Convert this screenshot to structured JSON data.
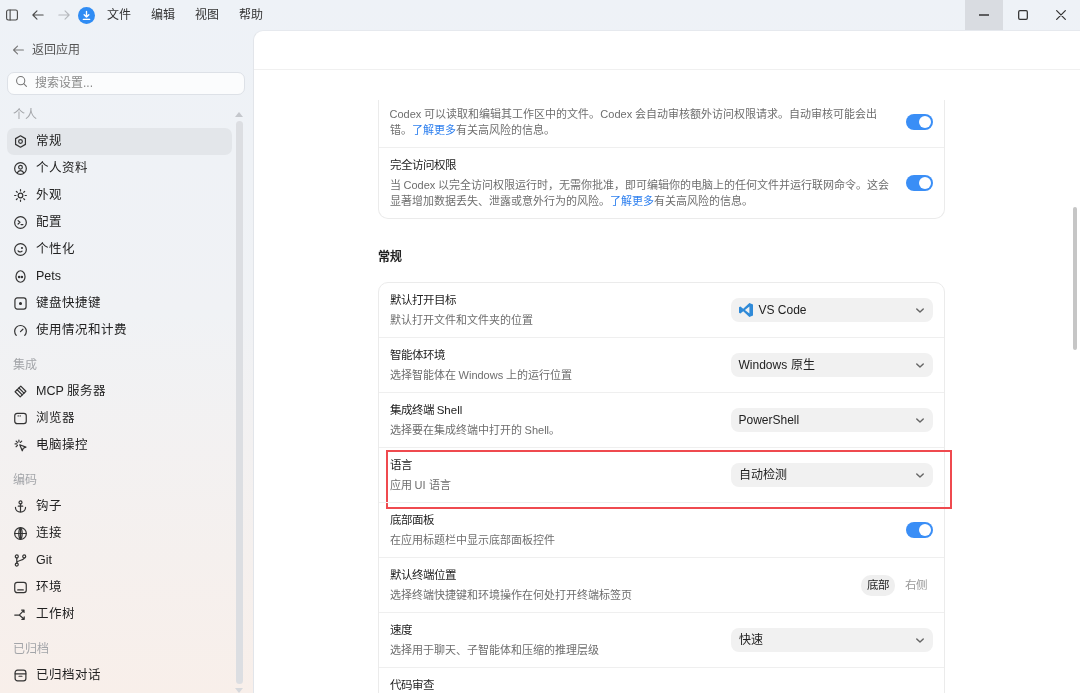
{
  "titlebar": {
    "nav_buttons": [
      {
        "kind": "sidebar",
        "disabled": false
      },
      {
        "kind": "back",
        "disabled": false
      },
      {
        "kind": "forward",
        "disabled": true
      }
    ],
    "menu": [
      "文件",
      "编辑",
      "视图",
      "帮助"
    ],
    "window_controls": [
      {
        "kind": "minimize",
        "hovered": true
      },
      {
        "kind": "maximize",
        "hovered": false
      },
      {
        "kind": "close",
        "hovered": false
      }
    ]
  },
  "sidebar": {
    "back_link": "返回应用",
    "search": {
      "placeholder": "搜索设置..."
    },
    "sections": [
      {
        "title": "个人",
        "items": [
          {
            "label": "常规",
            "selected": true
          },
          {
            "label": "个人资料",
            "selected": false
          },
          {
            "label": "外观",
            "selected": false
          },
          {
            "label": "配置",
            "selected": false
          },
          {
            "label": "个性化",
            "selected": false
          },
          {
            "label": "Pets",
            "selected": false
          },
          {
            "label": "键盘快捷键",
            "selected": false
          },
          {
            "label": "使用情况和计费",
            "selected": false
          }
        ]
      },
      {
        "title": "集成",
        "items": [
          {
            "label": "MCP 服务器",
            "selected": false
          },
          {
            "label": "浏览器",
            "selected": false
          },
          {
            "label": "电脑操控",
            "selected": false
          }
        ]
      },
      {
        "title": "编码",
        "items": [
          {
            "label": "钩子",
            "selected": false
          },
          {
            "label": "连接",
            "selected": false
          },
          {
            "label": "Git",
            "selected": false
          },
          {
            "label": "环境",
            "selected": false
          },
          {
            "label": "工作树",
            "selected": false
          }
        ]
      },
      {
        "title": "已归档",
        "items": [
          {
            "label": "已归档对话",
            "selected": false
          }
        ]
      }
    ]
  },
  "content": {
    "permissions": {
      "rows": [
        {
          "kind": "toggle",
          "on": true,
          "description_parts": [
            {
              "kind": "text",
              "text": "Codex 可以读取和编辑其工作区中的文件。Codex 会自动审核额外访问权限请求。自动审核可能会出错。"
            },
            {
              "kind": "link",
              "text": "了解更多"
            },
            {
              "kind": "text",
              "text": "有关高风险的信息。"
            }
          ]
        },
        {
          "kind": "toggle",
          "on": true,
          "title": "完全访问权限",
          "description_parts": [
            {
              "kind": "text",
              "text": "当 Codex 以完全访问权限运行时，无需你批准，即可编辑你的电脑上的任何文件并运行联网命令。这会显著增加数据丢失、泄露或意外行为的风险。"
            },
            {
              "kind": "link",
              "text": "了解更多"
            },
            {
              "kind": "text",
              "text": "有关高风险的信息。"
            }
          ]
        }
      ]
    },
    "general": {
      "title": "常规",
      "rows": [
        {
          "kind": "select",
          "title": "默认打开目标",
          "description": "默认打开文件和文件夹的位置",
          "value": "VS Code",
          "logo": true,
          "highlighted": false
        },
        {
          "kind": "select",
          "title": "智能体环境",
          "description": "选择智能体在 Windows 上的运行位置",
          "value": "Windows 原生",
          "highlighted": false
        },
        {
          "kind": "select",
          "title": "集成终端 Shell",
          "description": "选择要在集成终端中打开的 Shell。",
          "value": "PowerShell",
          "highlighted": false
        },
        {
          "kind": "select",
          "title": "语言",
          "description": "应用 UI 语言",
          "value": "自动检测",
          "highlighted": true
        },
        {
          "kind": "toggle",
          "title": "底部面板",
          "description": "在应用标题栏中显示底部面板控件",
          "on": true,
          "highlighted": false
        },
        {
          "kind": "segmented",
          "title": "默认终端位置",
          "description": "选择终端快捷键和环境操作在何处打开终端标签页",
          "options": [
            {
              "label": "底部",
              "selected": true
            },
            {
              "label": "右侧",
              "selected": false
            }
          ],
          "highlighted": false
        },
        {
          "kind": "select",
          "title": "速度",
          "description": "选择用于聊天、子智能体和压缩的推理层级",
          "value": "快速",
          "highlighted": false
        },
        {
          "kind": "label",
          "title": "代码审查",
          "highlighted": false
        }
      ]
    }
  }
}
